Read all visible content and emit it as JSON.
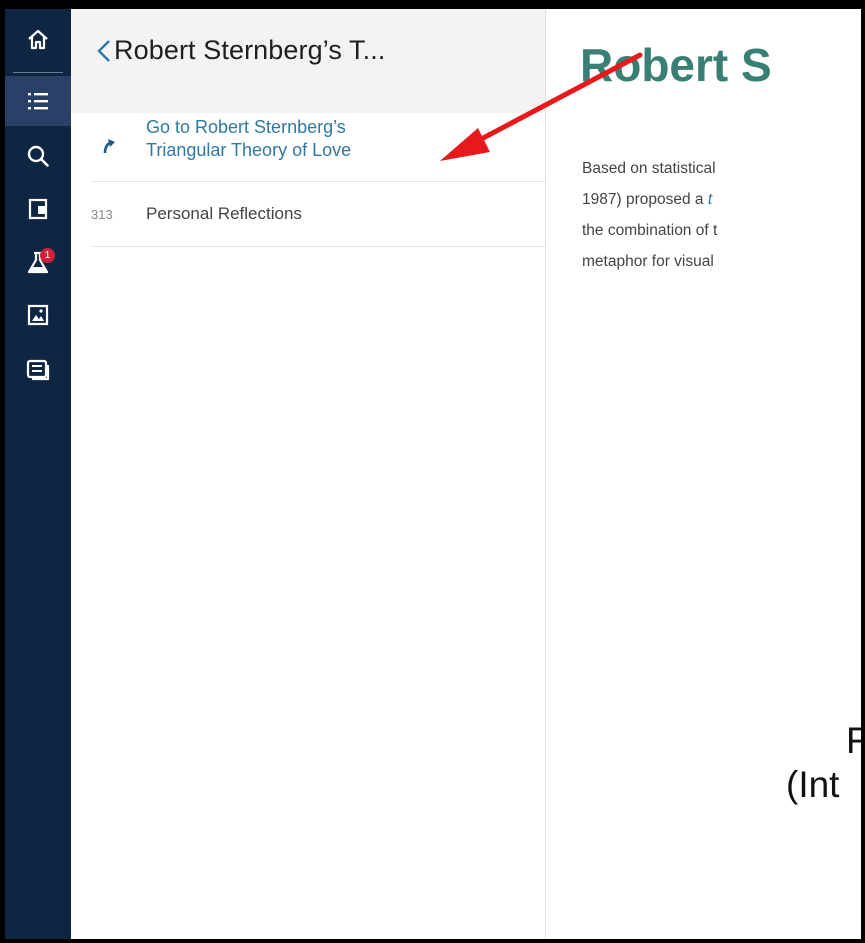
{
  "rail": {
    "items": [
      {
        "name": "home",
        "icon": "home-icon"
      },
      {
        "name": "outline",
        "icon": "list-icon",
        "active": true
      },
      {
        "name": "search",
        "icon": "search-icon"
      },
      {
        "name": "exit",
        "icon": "exit-door-icon"
      },
      {
        "name": "lab",
        "icon": "flask-icon",
        "badge": "1"
      },
      {
        "name": "images",
        "icon": "image-icon"
      },
      {
        "name": "notes",
        "icon": "notes-icon"
      }
    ],
    "background": "#0f2643",
    "active_background": "#2a4066",
    "badge_color": "#d0213b"
  },
  "panel": {
    "back_title": "Robert Sternberg’s T...",
    "rows": [
      {
        "icon": "redirect-arrow-icon",
        "label": "Go to Robert Sternberg’s Triangular Theory of Love",
        "label_line1": "Go to Robert Sternberg’s",
        "label_line2": "Triangular Theory of Love"
      },
      {
        "page": "313",
        "label": "Personal Reflections"
      }
    ],
    "link_color": "#2f78a3"
  },
  "reader": {
    "title": "Robert S",
    "paragraph": [
      "Based on statistical",
      "1987) proposed a t",
      "the combination of t",
      "metaphor for visual"
    ],
    "figure_lines": [
      "F",
      "(Int"
    ],
    "title_color": "#3a7f75"
  },
  "annotation": {
    "arrow_color": "#e8191a"
  }
}
